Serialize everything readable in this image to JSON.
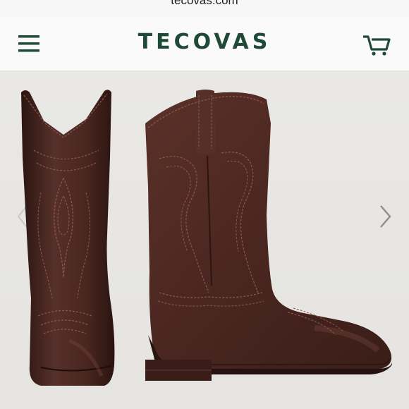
{
  "browser": {
    "url": "tecovas.com"
  },
  "header": {
    "brand": "TECOVAS",
    "menu_icon": "hamburger-menu-icon",
    "cart_icon": "cart-icon"
  },
  "gallery": {
    "prev_icon": "chevron-left-icon",
    "next_icon": "chevron-right-icon",
    "image": "brown-leather-cowboy-boots",
    "colors": {
      "leather": "#4a2620",
      "leather_dark": "#2e1612",
      "stitch": "#8a5a48",
      "brand": "#1f4a37"
    }
  }
}
